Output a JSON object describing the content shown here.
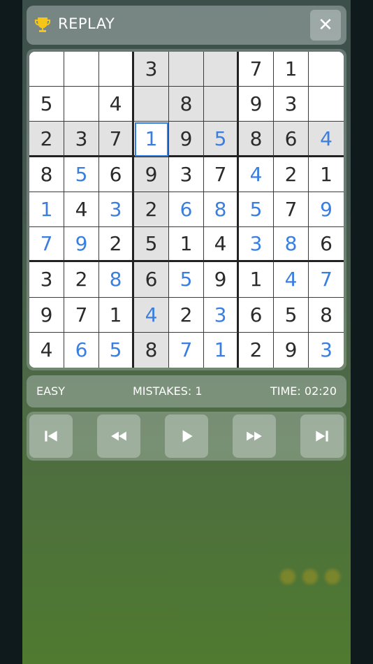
{
  "header": {
    "title": "REPLAY",
    "trophy_icon": "trophy-icon",
    "close_icon": "close-icon",
    "close_symbol": "✕"
  },
  "board": {
    "rows": [
      [
        "",
        "",
        "",
        "3",
        "",
        "",
        "7",
        "1",
        ""
      ],
      [
        "5",
        "",
        "4",
        "",
        "8",
        "",
        "9",
        "3",
        ""
      ],
      [
        "2",
        "3",
        "7",
        "1",
        "9",
        "5",
        "8",
        "6",
        "4"
      ],
      [
        "8",
        "5",
        "6",
        "9",
        "3",
        "7",
        "4",
        "2",
        "1"
      ],
      [
        "1",
        "4",
        "3",
        "2",
        "6",
        "8",
        "5",
        "7",
        "9"
      ],
      [
        "7",
        "9",
        "2",
        "5",
        "1",
        "4",
        "3",
        "8",
        "6"
      ],
      [
        "3",
        "2",
        "8",
        "6",
        "5",
        "9",
        "1",
        "4",
        "7"
      ],
      [
        "9",
        "7",
        "1",
        "4",
        "2",
        "3",
        "6",
        "5",
        "8"
      ],
      [
        "4",
        "6",
        "5",
        "8",
        "7",
        "1",
        "2",
        "9",
        "3"
      ]
    ],
    "user_filled": [
      [
        2,
        3
      ],
      [
        2,
        5
      ],
      [
        2,
        8
      ],
      [
        3,
        1
      ],
      [
        3,
        6
      ],
      [
        4,
        0
      ],
      [
        4,
        2
      ],
      [
        4,
        4
      ],
      [
        4,
        5
      ],
      [
        4,
        6
      ],
      [
        4,
        8
      ],
      [
        5,
        0
      ],
      [
        5,
        1
      ],
      [
        5,
        6
      ],
      [
        5,
        7
      ],
      [
        6,
        2
      ],
      [
        6,
        4
      ],
      [
        6,
        7
      ],
      [
        6,
        8
      ],
      [
        7,
        3
      ],
      [
        7,
        5
      ],
      [
        8,
        1
      ],
      [
        8,
        2
      ],
      [
        8,
        4
      ],
      [
        8,
        5
      ],
      [
        8,
        8
      ]
    ],
    "selected": [
      2,
      3
    ],
    "colors": {
      "given": "#2b2b2b",
      "user": "#3a7fe0",
      "highlight": "#e2e2e2",
      "selected_border": "#2f7de0"
    }
  },
  "info": {
    "difficulty": "EASY",
    "mistakes": "MISTAKES: 1",
    "time": "TIME: 02:20"
  },
  "controls": [
    {
      "name": "skip-to-start-button",
      "icon": "skip-start-icon"
    },
    {
      "name": "rewind-button",
      "icon": "rewind-icon"
    },
    {
      "name": "play-button",
      "icon": "play-icon"
    },
    {
      "name": "fast-forward-button",
      "icon": "fast-forward-icon"
    },
    {
      "name": "skip-to-end-button",
      "icon": "skip-end-icon"
    }
  ]
}
